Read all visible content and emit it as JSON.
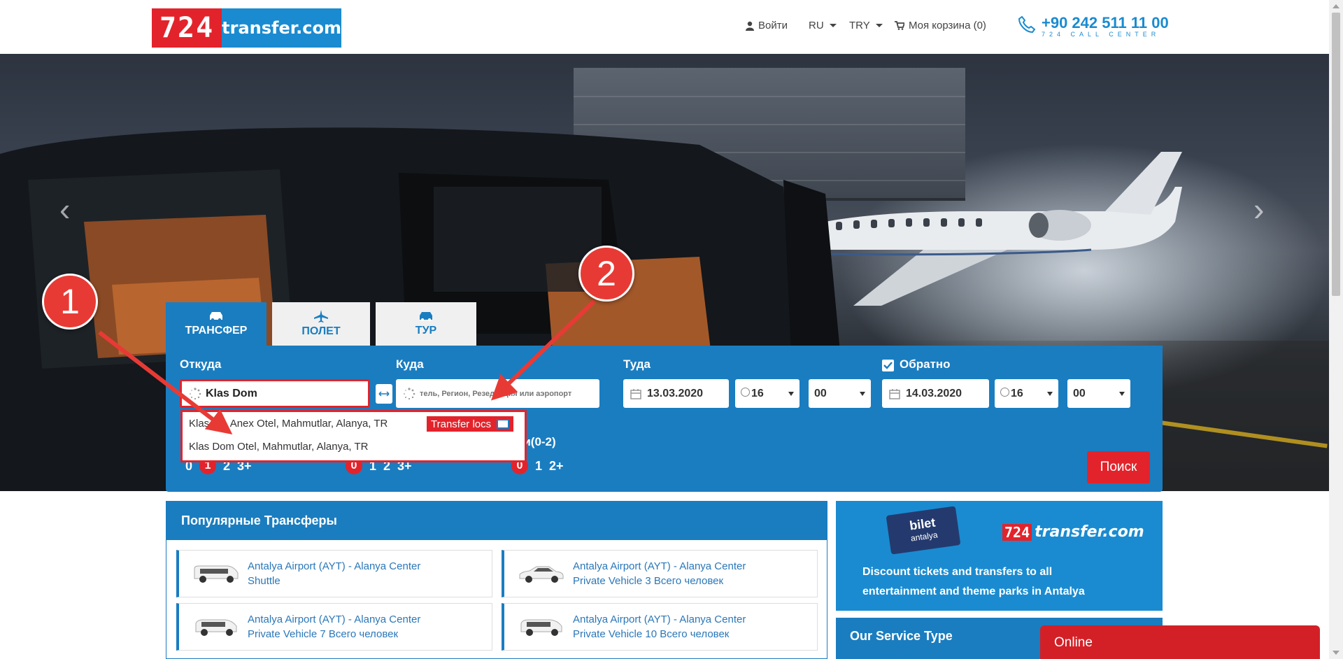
{
  "header": {
    "logo_num": "724",
    "logo_word": "transfer.com",
    "login": "Войти",
    "language": "RU",
    "currency": "TRY",
    "cart": "Моя корзина (0)",
    "phone": "+90 242 511 11 00",
    "phone_sub": "724 CALL CENTER"
  },
  "tabs": [
    {
      "label": "ТРАНСФЕР",
      "icon": "car-icon",
      "active": true
    },
    {
      "label": "ПОЛЕТ",
      "icon": "plane-icon",
      "active": false
    },
    {
      "label": "ТУР",
      "icon": "car-icon",
      "active": false
    }
  ],
  "search": {
    "from_label": "Откуда",
    "from_value": "Klas Dom",
    "to_label": "Куда",
    "to_placeholder": "тель, Регион, Резеденция или аэропорт",
    "depart_label": "Туда",
    "depart_date": "13.03.2020",
    "depart_hour": "16",
    "depart_min": "00",
    "return_label": "Обратно",
    "return_checked": true,
    "return_date": "14.03.2020",
    "return_hour": "16",
    "return_min": "00",
    "children_label": "ти(0-2)",
    "pax_adults": [
      "0",
      "1",
      "2",
      "3+"
    ],
    "pax_adults_selected": "1",
    "pax_children": [
      "0",
      "1",
      "2",
      "3+"
    ],
    "pax_children_selected": "0",
    "pax_infants": [
      "0",
      "1",
      "2+"
    ],
    "pax_infants_selected": "0",
    "button": "Поиск"
  },
  "autocomplete": {
    "item1": "Klas Dom Anex Otel, Mahmutlar, Alanya, TR",
    "item1_visible": "Klas ",
    "item1_tail": " Anex Otel, Mahmutlar, Alanya, TR",
    "tag": "Transfer locs",
    "item2": "Klas Dom Otel, Mahmutlar, Alanya, TR"
  },
  "annotations": {
    "badge1": "1",
    "badge2": "2",
    "color": "#e83a35"
  },
  "popular": {
    "title": "Популярные Трансферы",
    "routes": [
      {
        "line1": "Antalya Airport (AYT) - Alanya Center",
        "line2": "Shuttle"
      },
      {
        "line1": "Antalya Airport (AYT) - Alanya Center",
        "line2": "Private Vehicle 3 Всего человек"
      },
      {
        "line1": "Antalya Airport (AYT) - Alanya Center",
        "line2": "Private Vehicle 7 Всего человек"
      },
      {
        "line1": "Antalya Airport (AYT) - Alanya Center",
        "line2": "Private Vehicle 10 Всего человек"
      }
    ]
  },
  "promo": {
    "bilet": "bilet",
    "bilet_sub": "antalya",
    "logo_num": "724",
    "logo_word": "transfer.com",
    "text1": "Discount tickets and transfers to all",
    "text2": "entertainment and theme parks in Antalya"
  },
  "service_title": "Our Service Type",
  "online": "Online",
  "colors": {
    "brand_blue": "#1a7dc0",
    "brand_red": "#e3232b"
  }
}
